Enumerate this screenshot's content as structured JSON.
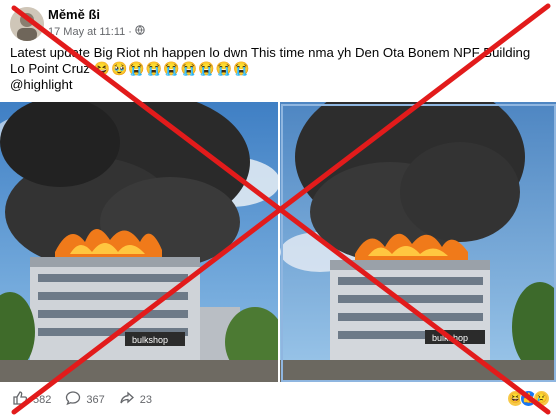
{
  "post": {
    "author": "Měmě ßi",
    "date": "17 May at 11:11",
    "dot": "·",
    "text": "Latest update Big Riot nh happen lo dwn This time nma yh Den Ota Bonem  NPF Building Lo Point Cruz",
    "emojis": "😆🥹😭😭😭😭😭😭😭",
    "mention": "@highlight"
  },
  "photos": {
    "left_sign": "bulkshop",
    "right_sign": "bulkshop"
  },
  "footer": {
    "likes": "582",
    "comments": "367",
    "shares": "23"
  },
  "colors": {
    "cross": "#e21b1b",
    "meta": "#65676b",
    "photo_frame": "#8fb6e0"
  }
}
